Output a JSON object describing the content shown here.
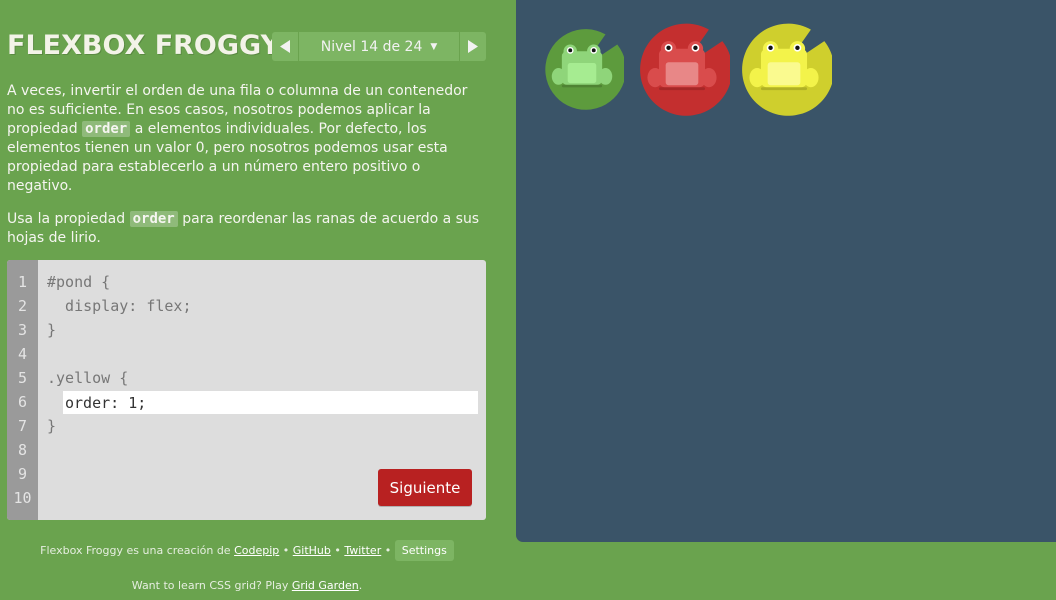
{
  "app": {
    "title": "FLEXBOX FROGGY"
  },
  "level_nav": {
    "label": "Nivel 14 de 24",
    "prev_icon": "triangle-left-icon",
    "next_icon": "triangle-right-icon",
    "dropdown_icon": "caret-down-icon"
  },
  "instructions": {
    "p1_before": "A veces, invertir el orden de una fila o columna de un contenedor no es suficiente. En esos casos, nosotros podemos aplicar la propiedad ",
    "p1_code": "order",
    "p1_after": " a elementos individuales. Por defecto, los elementos tienen un valor 0, pero nosotros podemos usar esta propiedad para establecerlo a un número entero positivo o negativo.",
    "p2_before": "Usa la propiedad ",
    "p2_code": "order",
    "p2_after": " para reordenar las ranas de acuerdo a sus hojas de lirio."
  },
  "editor": {
    "line_numbers": [
      "1",
      "2",
      "3",
      "4",
      "5",
      "6",
      "7",
      "8",
      "9",
      "10"
    ],
    "lines": [
      "#pond {",
      "  display: flex;",
      "}",
      "",
      ".yellow {",
      "",
      "}",
      "",
      "",
      ""
    ],
    "input_value": "order: 1;",
    "next_button_label": "Siguiente"
  },
  "footer": {
    "credit_prefix": "Flexbox Froggy es una creación de ",
    "codepip": "Codepip",
    "sep": " • ",
    "github": "GitHub",
    "twitter": "Twitter",
    "settings": "Settings",
    "promo_prefix": "Want to learn CSS grid? Play ",
    "grid_garden": "Grid Garden",
    "promo_suffix": "."
  },
  "pond": {
    "frogs": [
      {
        "color": "green",
        "frog_color": "#8fd57a",
        "belly_color": "#a6ec91",
        "pad_color": "#5d9b3d"
      },
      {
        "color": "red",
        "frog_color": "#d94c4c",
        "belly_color": "#e88787",
        "pad_color": "#c42f2f"
      },
      {
        "color": "yellow",
        "frog_color": "#f3f34a",
        "belly_color": "#fafa8f",
        "pad_color": "#cfcf2d"
      }
    ]
  },
  "colors": {
    "background": "#6aa34e",
    "pond": "#3a5468",
    "next_button": "#b82121"
  }
}
